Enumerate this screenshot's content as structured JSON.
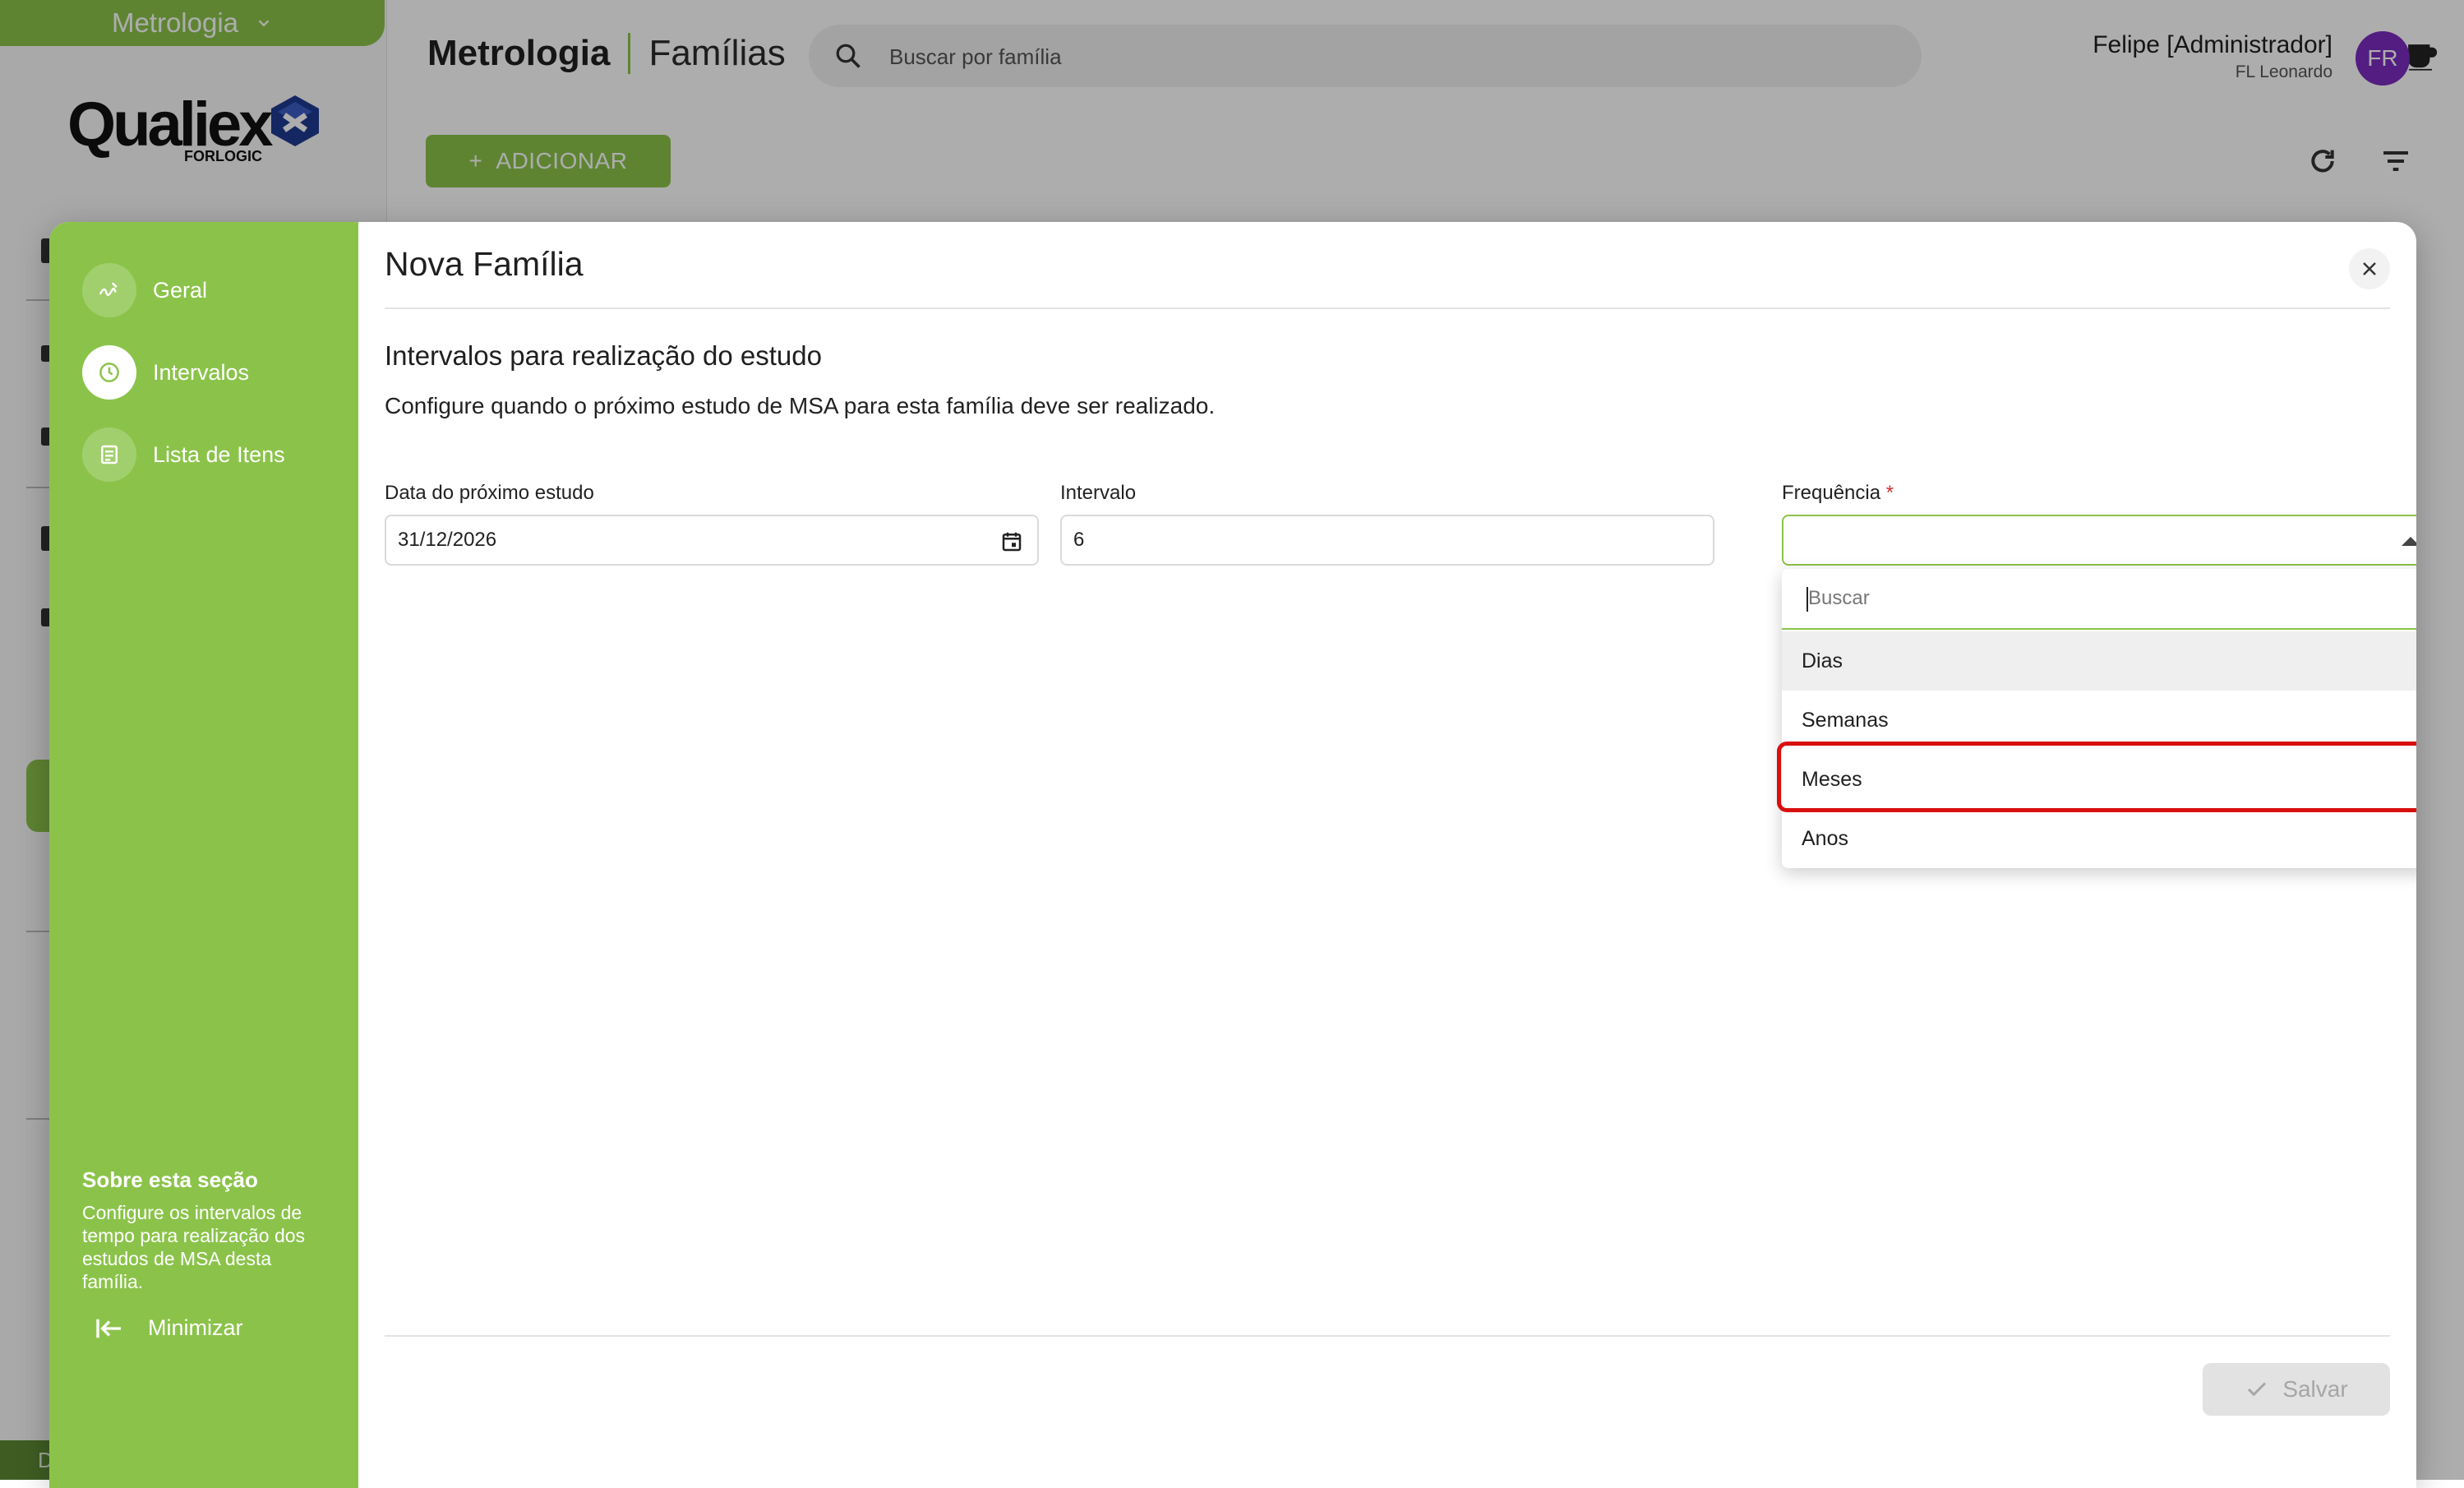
{
  "app": {
    "module": "Metrologia",
    "logo": {
      "brand": "Qualiex",
      "sub": "FORLOGIC"
    },
    "breadcrumb": {
      "section": "Metrologia",
      "page": "Famílias"
    },
    "search": {
      "placeholder": "Buscar por família"
    },
    "user": {
      "name": "Felipe [Administrador]",
      "org": "FL Leonardo",
      "initials": "FR"
    },
    "add_button": "ADICIONAR",
    "sidebar_bottom": "D"
  },
  "modal": {
    "title": "Nova Família",
    "steps": [
      {
        "label": "Geral",
        "icon": "signature-icon"
      },
      {
        "label": "Intervalos",
        "icon": "clock-icon",
        "active": true
      },
      {
        "label": "Lista de Itens",
        "icon": "list-icon"
      }
    ],
    "about": {
      "heading": "Sobre esta seção",
      "text": "Configure os intervalos de tempo para realização dos estudos de MSA desta família."
    },
    "minimize": "Minimizar",
    "section_title": "Intervalos para realização do estudo",
    "section_desc": "Configure quando o próximo estudo de MSA para esta família deve ser realizado.",
    "fields": {
      "date": {
        "label": "Data do próximo estudo",
        "value": "31/12/2026"
      },
      "interval": {
        "label": "Intervalo",
        "value": "6"
      },
      "frequency": {
        "label": "Frequência",
        "required": "*",
        "value": ""
      }
    },
    "dropdown": {
      "search_placeholder": "Buscar",
      "options": [
        "Dias",
        "Semanas",
        "Meses",
        "Anos"
      ],
      "hovered": "Dias",
      "highlighted": "Meses"
    },
    "save": "Salvar"
  },
  "colors": {
    "accent": "#8bc34a",
    "highlight": "#d90f0f",
    "avatar": "#7b2cbf"
  }
}
